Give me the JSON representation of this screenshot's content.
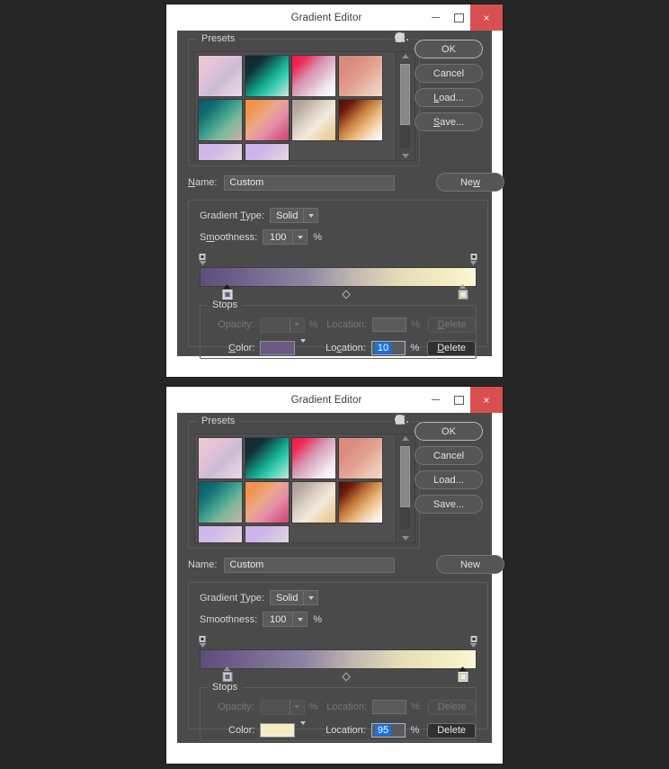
{
  "window": {
    "title": "Gradient Editor",
    "controls": {
      "minimize": "minimize-icon",
      "maximize": "maximize-icon",
      "close": "×"
    }
  },
  "presets": {
    "label": "Presets",
    "gear_icon": "gear-icon",
    "swatches": [
      {
        "name": "pink-lavender",
        "css": "linear-gradient(135deg,#f0c8d0 0%,#e8c4d8 22%,#d9c0d8 45%,#c8bcd4 58%,#d8c8dc 72%,#ead8e4 100%)"
      },
      {
        "name": "teal-dark",
        "css": "linear-gradient(135deg,#10282f 0%,#123037 25%,#12a88f 55%,#3fd0b4 72%,#cfe6dd 100%)"
      },
      {
        "name": "crimson-white",
        "css": "linear-gradient(135deg,#f01844 0%,#ef2a55 18%,#d892b0 42%,#e0bdd0 60%,#f4eaf0 80%,#ffffff 100%)"
      },
      {
        "name": "salmon-peach",
        "css": "linear-gradient(135deg,#d8897c 0%,#db8c7e 25%,#e4a695 55%,#edc4b4 78%,#f3d9cc 100%)"
      },
      {
        "name": "teal-green",
        "css": "linear-gradient(135deg,#0c5764 0%,#116a72 22%,#3f9e8c 48%,#7cb99a 68%,#cbb2a4 100%)"
      },
      {
        "name": "orange-pink",
        "css": "linear-gradient(135deg,#f58d4a 0%,#f2964f 20%,#eba98c 42%,#e48ca6 65%,#d85f86 85%,#c84a72 100%)"
      },
      {
        "name": "taupe-cream",
        "css": "linear-gradient(135deg,#a89c96 0%,#b6aaa2 18%,#ded3c6 42%,#f2eadb 60%,#efd6ac 80%,#e8c28c 100%)"
      },
      {
        "name": "brown-tan",
        "css": "linear-gradient(135deg,#4a0d08 0%,#6b1a0c 18%,#c4793a 42%,#e8b77c 62%,#f6e5cf 82%,#ffffff 100%)"
      },
      {
        "name": "lavender-cream-a",
        "css": "linear-gradient(135deg,#ceb4e8 0%,#d2bbe8 30%,#dccfe4 55%,#ecdfcf 80%,#f4eccd 100%)"
      },
      {
        "name": "lavender-cream-b",
        "css": "linear-gradient(135deg,#cbb0ea 0%,#cfb6e9 30%,#dacee5 58%,#eee0cf 82%,#f6efd0 100%)"
      }
    ]
  },
  "buttons": {
    "ok": "OK",
    "cancel": "Cancel",
    "load": "Load...",
    "save": "Save...",
    "new": "New"
  },
  "name_field": {
    "label": "Name:",
    "value": "Custom"
  },
  "gradient_type": {
    "label": "Gradient Type:",
    "value": "Solid"
  },
  "smoothness": {
    "label": "Smoothness:",
    "value": "100",
    "unit": "%"
  },
  "stops": {
    "title": "Stops",
    "opacity_label": "Opacity:",
    "opacity_value": "",
    "opacity_unit": "%",
    "opacity_location_label": "Location:",
    "opacity_location_value": "",
    "color_label": "Color:",
    "color_location_label": "Location:",
    "location_unit": "%",
    "delete_label": "Delete"
  },
  "dialogs": [
    {
      "id": "dialog-top",
      "gradient_css": "linear-gradient(90deg,#5e4d78 0%,#6b5a85 10%,#8e84a4 38%,#c0b6b0 55%,#e4dcb8 72%,#f2ecc2 88%,#fbf6d4 100%)",
      "color_stops": [
        {
          "position": 10,
          "color": "#6b5a85",
          "selected": true
        },
        {
          "position": 95,
          "color": "#f5eec4",
          "selected": false
        }
      ],
      "opacity_stops": [
        {
          "position": 1
        },
        {
          "position": 99
        }
      ],
      "midpoint": 53,
      "selected_color": "#6b5a85",
      "location_value": "10"
    },
    {
      "id": "dialog-bottom",
      "gradient_css": "linear-gradient(90deg,#5e4d78 0%,#6b5a85 10%,#8e84a4 38%,#c0b6b0 55%,#e4dcb8 72%,#f2ecc2 88%,#fbf6d4 100%)",
      "color_stops": [
        {
          "position": 10,
          "color": "#6b5a85",
          "selected": false
        },
        {
          "position": 95,
          "color": "#f5eec4",
          "selected": true
        }
      ],
      "opacity_stops": [
        {
          "position": 1
        },
        {
          "position": 99
        }
      ],
      "midpoint": 53,
      "selected_color": "#f5eec4",
      "location_value": "95"
    }
  ]
}
